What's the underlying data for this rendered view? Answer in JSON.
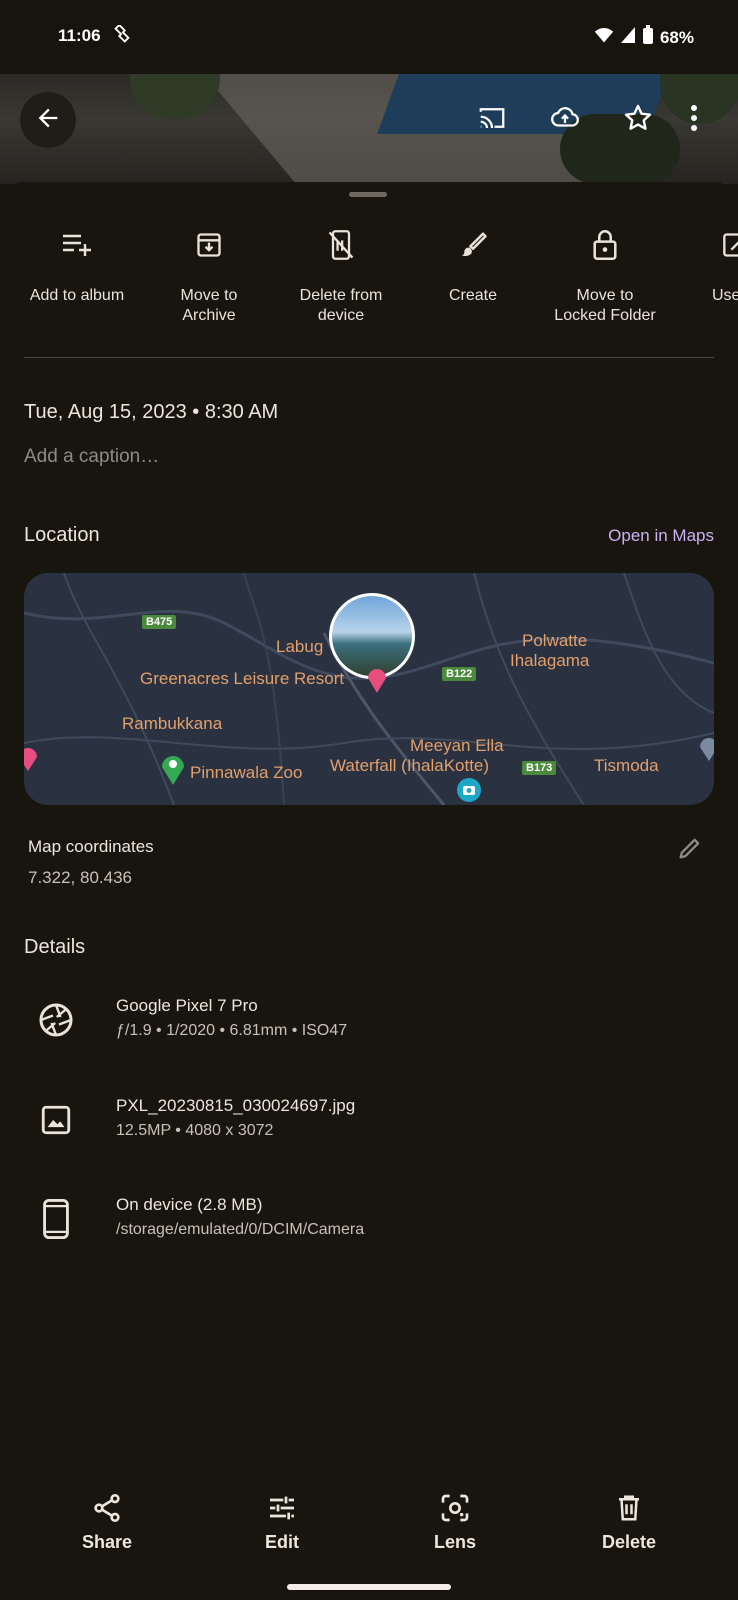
{
  "status": {
    "time": "11:06",
    "battery": "68%"
  },
  "actions": [
    {
      "label": "Add to album",
      "icon": "playlist-add-icon"
    },
    {
      "label": "Move to\nArchive",
      "icon": "archive-icon"
    },
    {
      "label": "Delete from\ndevice",
      "icon": "delete-device-icon"
    },
    {
      "label": "Create",
      "icon": "brush-icon"
    },
    {
      "label": "Move to\nLocked Folder",
      "icon": "lock-icon"
    },
    {
      "label": "Use",
      "icon": "open-in-icon"
    }
  ],
  "info": {
    "datetime": "Tue, Aug 15, 2023 • 8:30 AM",
    "caption_placeholder": "Add a caption…"
  },
  "location": {
    "title": "Location",
    "open_maps": "Open in Maps",
    "map_labels": [
      "Labug",
      "Greenacres Leisure Resort",
      "Polwatte",
      "Ihalagama",
      "Rambukkana",
      "Meeyan Ella",
      "Waterfall (IhalaKotte)",
      "Pinnawala Zoo",
      "Tismoda"
    ],
    "road_shields": [
      "B475",
      "B122",
      "B173"
    ],
    "coords_title": "Map coordinates",
    "coords_value": "7.322, 80.436"
  },
  "details": {
    "title": "Details",
    "items": [
      {
        "icon": "camera-aperture-icon",
        "line1": "Google Pixel 7 Pro",
        "line2": "ƒ/1.9  •  1/2020  •  6.81mm  •  ISO47"
      },
      {
        "icon": "image-icon",
        "line1": "PXL_20230815_030024697.jpg",
        "line2": "12.5MP  •  4080 x 3072"
      },
      {
        "icon": "phone-icon",
        "line1": "On device (2.8 MB)",
        "line2": "/storage/emulated/0/DCIM/Camera"
      }
    ]
  },
  "bottom_bar": {
    "share": "Share",
    "edit": "Edit",
    "lens": "Lens",
    "delete": "Delete"
  },
  "colors": {
    "background": "#18150f",
    "accent": "#c9b2f4",
    "map_label": "#e2a06b"
  }
}
